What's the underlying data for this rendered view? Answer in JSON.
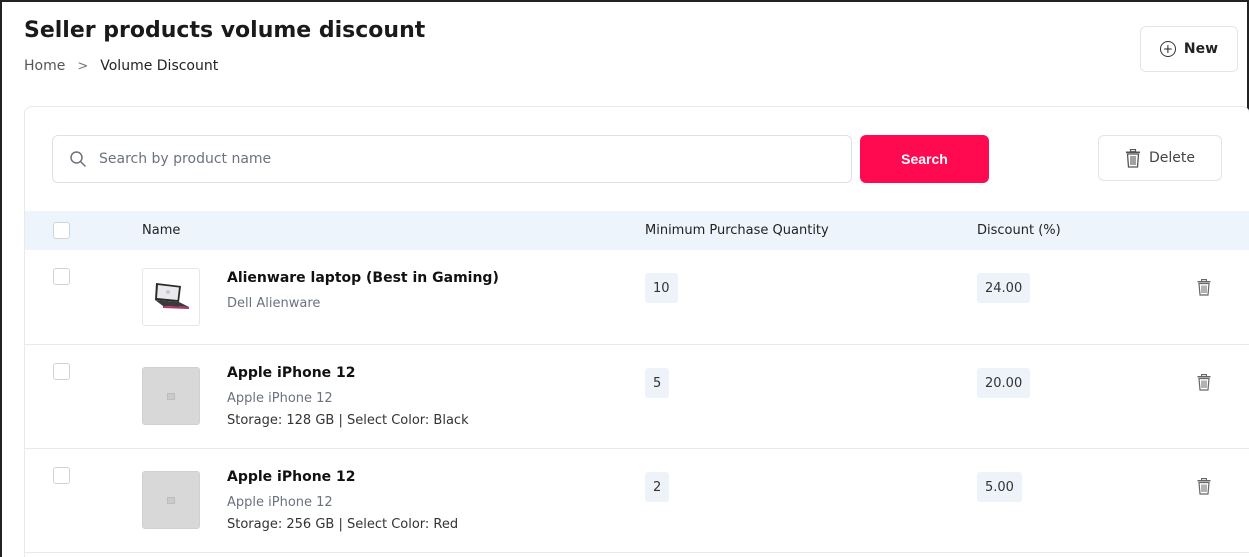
{
  "header": {
    "title": "Seller products volume discount",
    "breadcrumb": {
      "home": "Home",
      "separator": ">",
      "current": "Volume Discount"
    },
    "new_button_label": "New"
  },
  "toolbar": {
    "search_placeholder": "Search by product name",
    "search_value": "",
    "search_button_label": "Search",
    "delete_button_label": "Delete"
  },
  "table": {
    "columns": {
      "name": "Name",
      "min_qty": "Minimum Purchase Quantity",
      "discount": "Discount (%)"
    },
    "rows": [
      {
        "name": "Alienware laptop (Best in Gaming)",
        "subtitle": "Dell Alienware",
        "variant": "",
        "min_qty": "10",
        "discount": "24.00",
        "image": "laptop-image"
      },
      {
        "name": "Apple iPhone 12",
        "subtitle": "Apple iPhone 12",
        "variant": "Storage: 128 GB | Select Color: Black",
        "min_qty": "5",
        "discount": "20.00",
        "image": "placeholder-image"
      },
      {
        "name": "Apple iPhone 12",
        "subtitle": "Apple iPhone 12",
        "variant": "Storage: 256 GB | Select Color: Red",
        "min_qty": "2",
        "discount": "5.00",
        "image": "placeholder-image"
      }
    ]
  },
  "colors": {
    "accent": "#ff0a50",
    "table_header_bg": "#eef4fc",
    "pill_bg": "#eef3fa"
  }
}
